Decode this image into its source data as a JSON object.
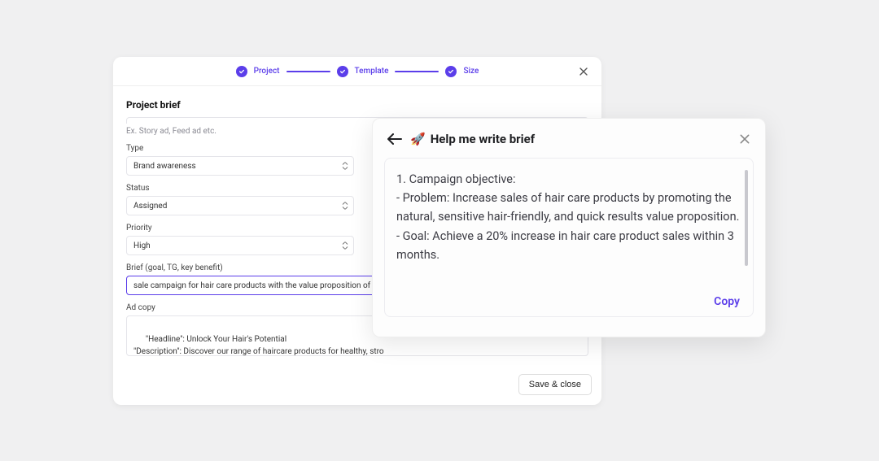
{
  "stepper": {
    "steps": [
      "Project",
      "Template",
      "Size"
    ]
  },
  "main": {
    "section_title": "Project brief",
    "hint": "Ex. Story ad, Feed ad etc.",
    "type_label": "Type",
    "type_value": "Brand awareness",
    "status_label": "Status",
    "status_value": "Assigned",
    "priority_label": "Priority",
    "priority_value": "High",
    "brief_label": "Brief (goal, TG, key benefit)",
    "brief_value": "sale campaign for hair care products with the value proposition of bein",
    "adcopy_label": "Ad copy",
    "adcopy_value": "\"Headline\": Unlock Your Hair's Potential\n\"Description\": Discover our range of haircare products for healthy, stro\n\"CTA\": Shop Now!",
    "save_label": "Save & close"
  },
  "side": {
    "title": "Help me write brief",
    "emoji": "🚀",
    "body": "1. Campaign objective:\n- Problem: Increase sales of hair care products by promoting the natural, sensitive hair-friendly, and quick results value proposition.\n- Goal: Achieve a 20% increase in hair care product sales within 3 months.",
    "copy_label": "Copy"
  }
}
